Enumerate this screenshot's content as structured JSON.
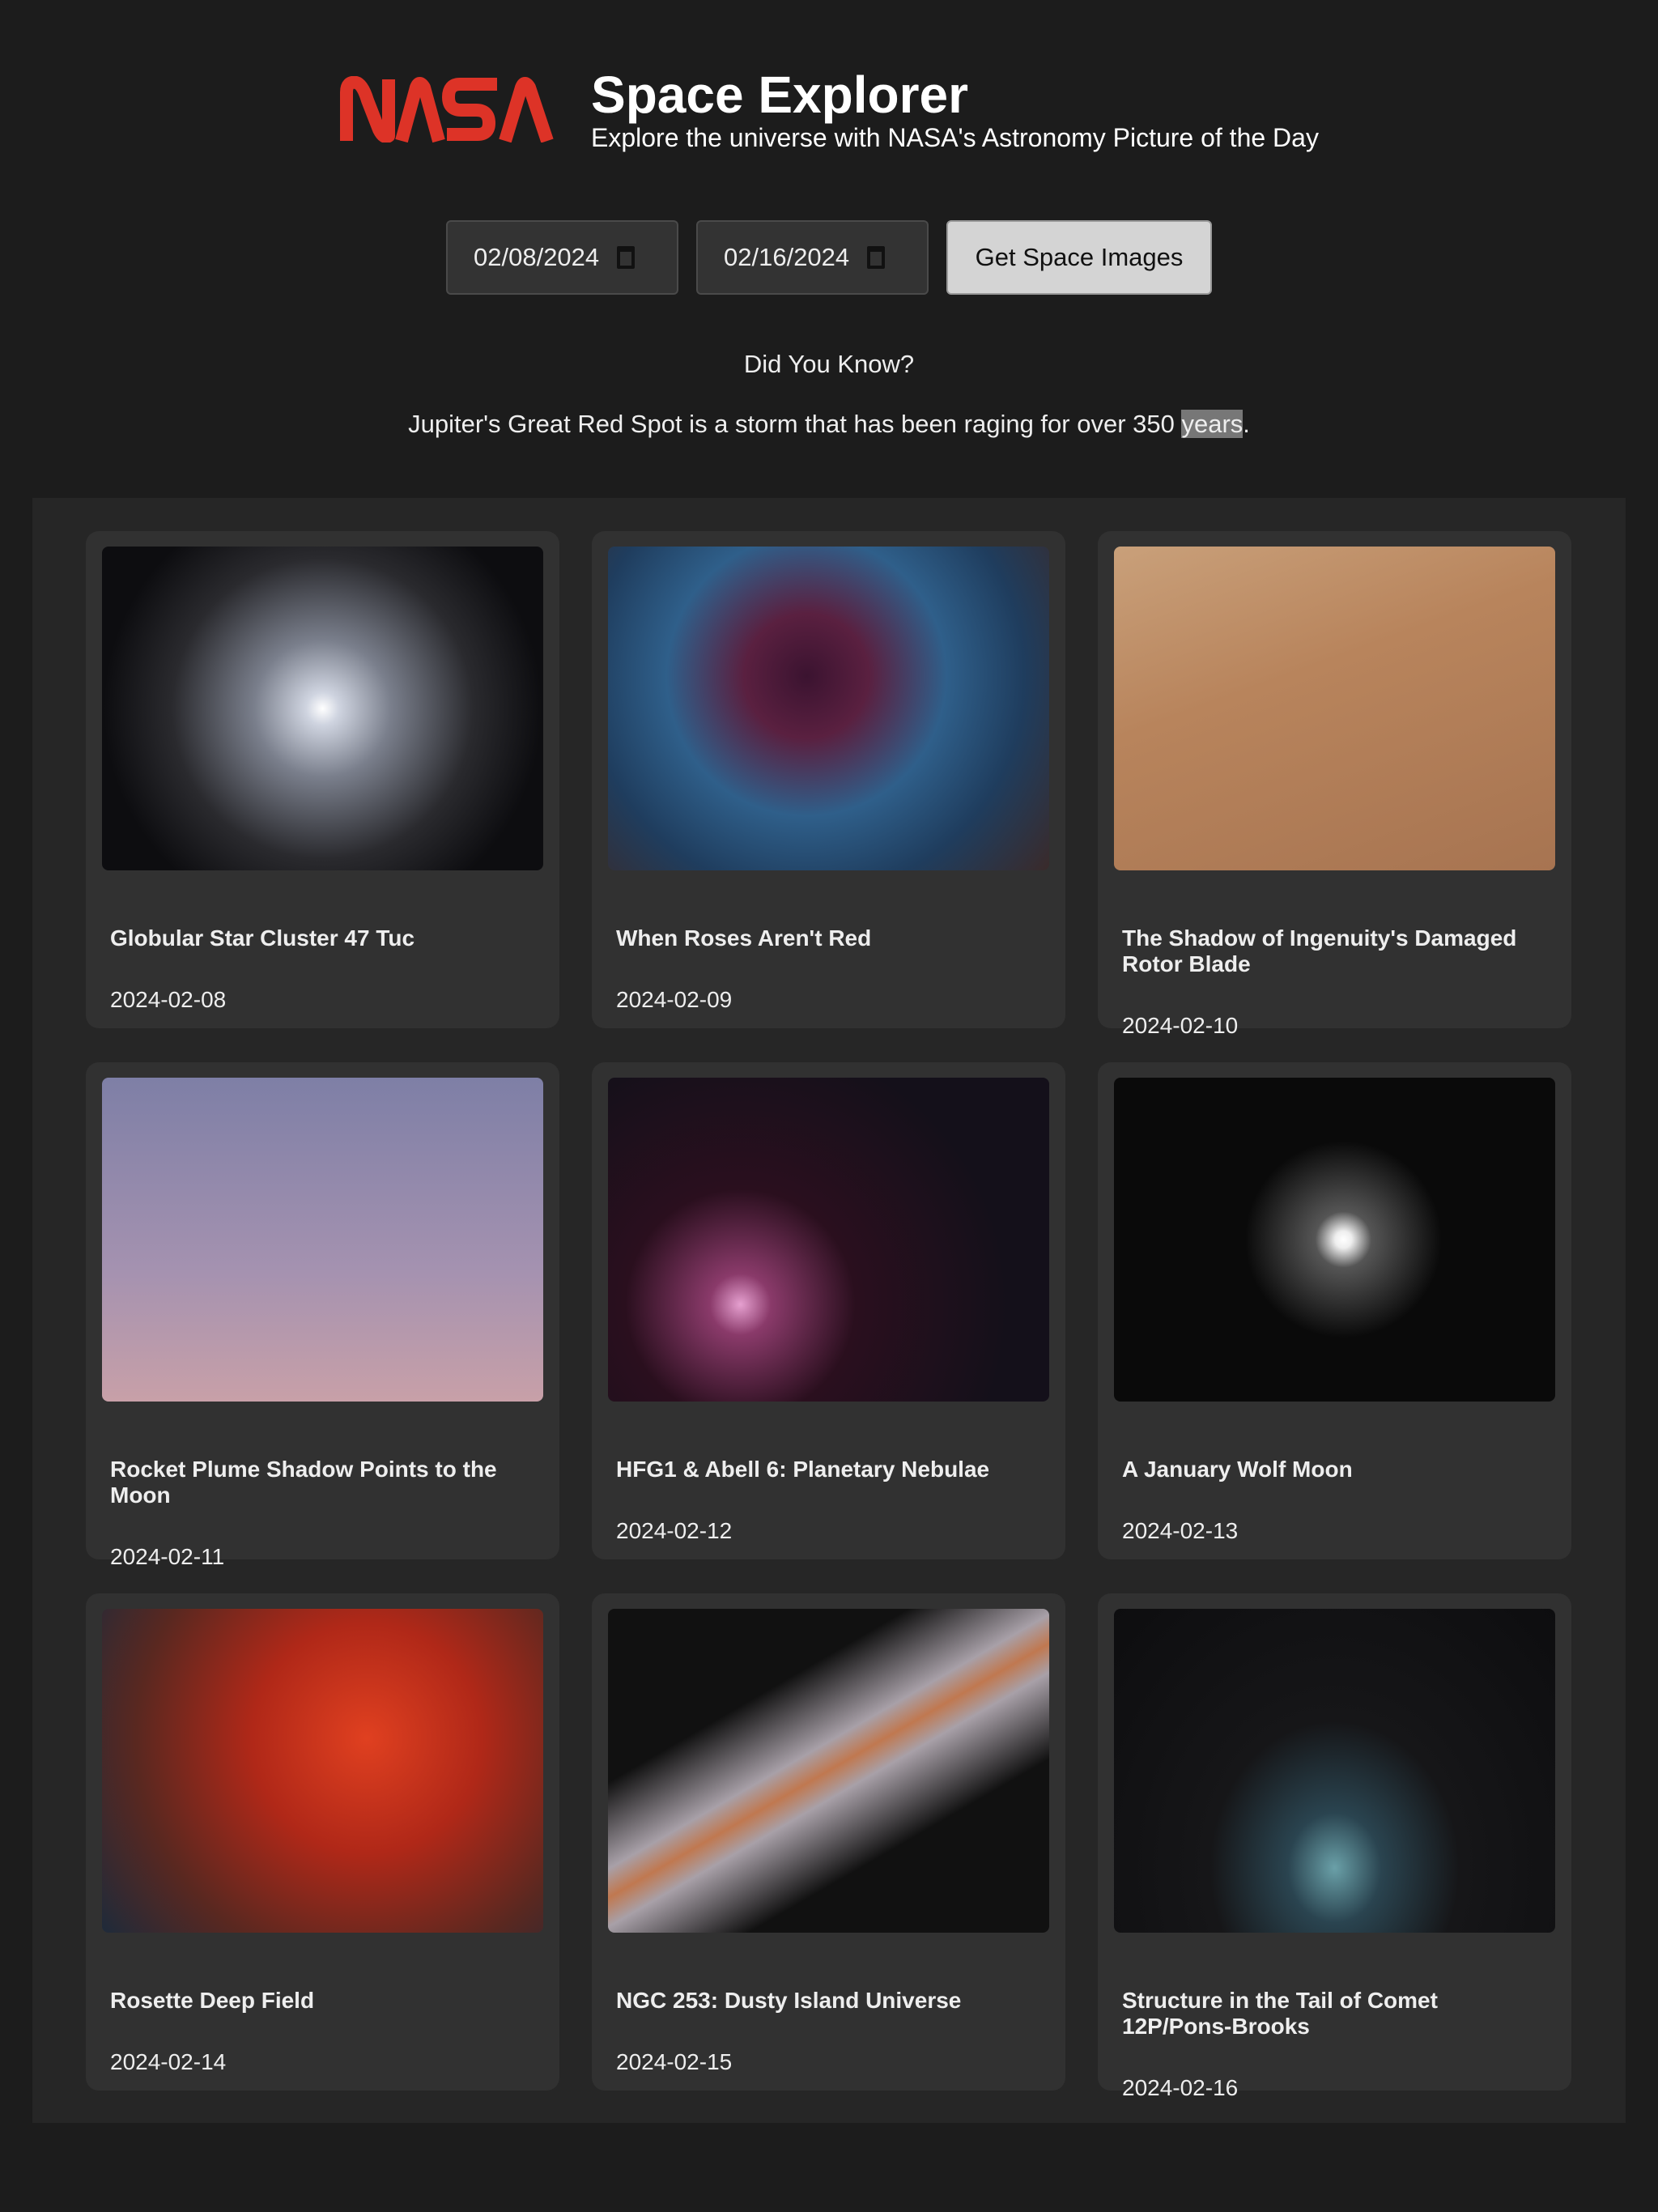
{
  "header": {
    "logo_text": "NASA",
    "title": "Space Explorer",
    "subtitle": "Explore the universe with NASA's Astronomy Picture of the Day"
  },
  "controls": {
    "start_date": "02/08/2024",
    "end_date": "02/16/2024",
    "button_label": "Get Space Images"
  },
  "fact": {
    "heading": "Did You Know?",
    "text": "Jupiter's Great Red Spot is a storm that has been raging for over 350 ",
    "highlighted": "years",
    "end": "."
  },
  "cards": [
    {
      "title": "Globular Star Cluster 47 Tuc",
      "date": "2024-02-08"
    },
    {
      "title": "When Roses Aren't Red",
      "date": "2024-02-09"
    },
    {
      "title": "The Shadow of Ingenuity's Damaged Rotor Blade",
      "date": "2024-02-10"
    },
    {
      "title": "Rocket Plume Shadow Points to the Moon",
      "date": "2024-02-11"
    },
    {
      "title": "HFG1 & Abell 6: Planetary Nebulae",
      "date": "2024-02-12"
    },
    {
      "title": "A January Wolf Moon",
      "date": "2024-02-13"
    },
    {
      "title": "Rosette Deep Field",
      "date": "2024-02-14"
    },
    {
      "title": "NGC 253: Dusty Island Universe",
      "date": "2024-02-15"
    },
    {
      "title": "Structure in the Tail of Comet 12P/Pons-Brooks",
      "date": "2024-02-16"
    }
  ],
  "colors": {
    "brand": "#dd3327",
    "background": "#1c1c1c",
    "card": "#313131"
  }
}
